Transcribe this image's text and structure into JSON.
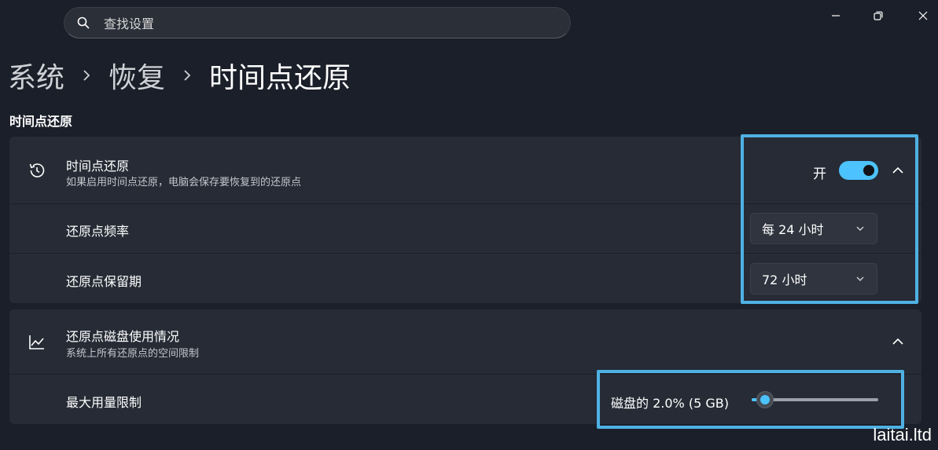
{
  "search": {
    "placeholder": "查找设置"
  },
  "breadcrumb": {
    "items": [
      "系统",
      "恢复",
      "时间点还原"
    ]
  },
  "section_title": "时间点还原",
  "restore_card": {
    "header": {
      "title": "时间点还原",
      "subtitle": "如果启用时间点还原，电脑会保存要恢复到的还原点",
      "toggle_label": "开",
      "toggle_on": true
    },
    "frequency": {
      "label": "还原点频率",
      "value": "每 24 小时"
    },
    "retention": {
      "label": "还原点保留期",
      "value": "72 小时"
    }
  },
  "disk_card": {
    "header": {
      "title": "还原点磁盘使用情况",
      "subtitle": "系统上所有还原点的空间限制"
    },
    "max_usage": {
      "label": "最大用量限制",
      "value_text": "磁盘的 2.0% (5 GB)",
      "slider_percent": 2.0
    }
  },
  "colors": {
    "accent": "#4cc2ff",
    "highlight": "#4fb1e3",
    "background": "#1b1f29",
    "card": "#262b35"
  },
  "watermark": "laitai.ltd"
}
